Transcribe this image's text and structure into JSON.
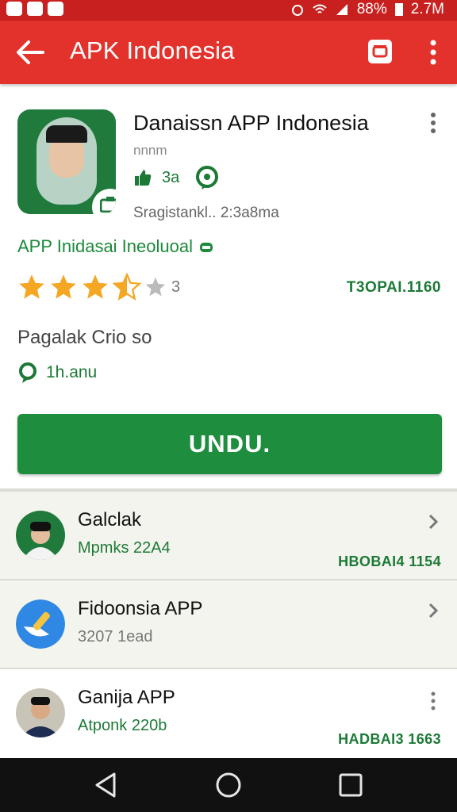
{
  "status_bar": {
    "battery": "88%",
    "time": "2.7M"
  },
  "toolbar": {
    "title": "APK Indonesia"
  },
  "app": {
    "name": "Danaissn APP Indonesia",
    "developer": "nnnm",
    "rating_value": "3a",
    "updated": "Sragistankl.. 2:3a8ma",
    "category": "APP Inidasai Ineoluoal",
    "stars": 3.5,
    "star_count": "3",
    "rating_right": "T3OPAI.1160",
    "size_label": "Pagalak Crio so",
    "installs": "1h.anu",
    "download_label": "UNDU."
  },
  "colors": {
    "toolbar": "#e3322c",
    "statusbar": "#c8201e",
    "primary_green": "#1e8e3e",
    "star": "#f5a623"
  },
  "list": [
    {
      "title": "Galclak",
      "subtitle": "Mpmks 22A4",
      "right": "HBOBAI4 1154",
      "trailing": "chevron"
    },
    {
      "title": "Fidoonsia APP",
      "subtitle": "3207 1ead",
      "right": "",
      "trailing": "chevron"
    },
    {
      "title": "Ganija APP",
      "subtitle": "Atponk 220b",
      "right": "HADBAI3 1663",
      "trailing": "more"
    }
  ]
}
